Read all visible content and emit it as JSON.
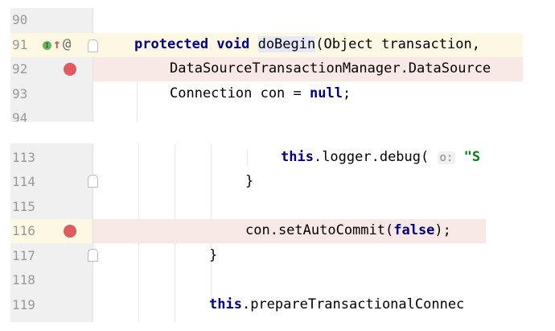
{
  "top": {
    "lines": [
      {
        "num": "90"
      },
      {
        "num": "91",
        "tokens": {
          "k1": "protected",
          "k2": "void",
          "name": "doBegin",
          "rest": "(Object transaction,"
        }
      },
      {
        "num": "92",
        "text": "DataSourceTransactionManager.DataSource"
      },
      {
        "num": "93",
        "t1": "Connection con = ",
        "k": "null",
        "t2": ";"
      },
      {
        "num": "94"
      }
    ],
    "icons": {
      "implements": "implementing-method-icon",
      "overrides": "override-arrow-up-icon",
      "annotation": "at-sign-icon"
    },
    "at": "@"
  },
  "bottom": {
    "lines": [
      {
        "num": "113",
        "k": "this",
        "t": ".logger.debug(",
        "hint": "o:",
        "str": "\"S"
      },
      {
        "num": "114",
        "text": "}"
      },
      {
        "num": "115"
      },
      {
        "num": "116",
        "t1": "con.setAutoCommit(",
        "k": "false",
        "t2": ");"
      },
      {
        "num": "117",
        "text": "}"
      },
      {
        "num": "118"
      },
      {
        "num": "119",
        "k": "this",
        "t": ".prepareTransactionalConnec"
      }
    ]
  },
  "colors": {
    "breakpoint": "#e05a5f",
    "keyword": "#000080",
    "string": "#067d17",
    "current_line": "#fdf8e3",
    "breakpoint_line": "#f9e9e6"
  }
}
